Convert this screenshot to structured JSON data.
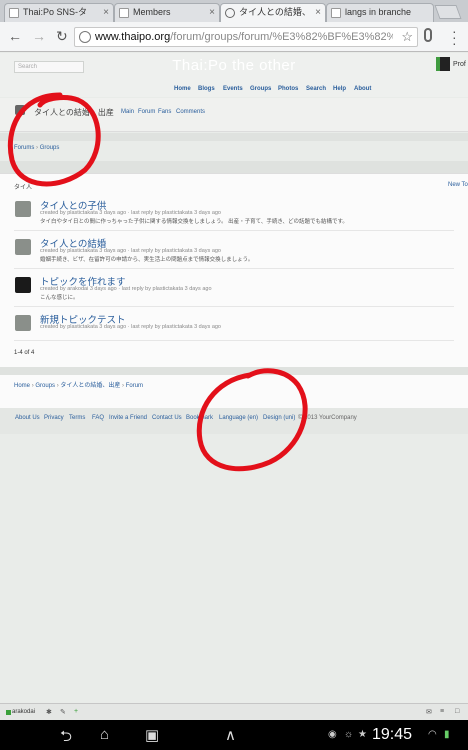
{
  "browser": {
    "tabs": [
      {
        "label": "Thai:Po SNS-タ",
        "favicon": "page-icon"
      },
      {
        "label": "Members",
        "favicon": "page-icon"
      },
      {
        "label": "タイ人との結婚、",
        "favicon": "page-icon",
        "active": true
      },
      {
        "label": "langs in branche",
        "favicon": "page-icon"
      }
    ],
    "tab_close": "×",
    "url_host": "www.thaipo.org",
    "url_path": "/forum/groups/forum/%E3%82%BF%E3%82%A4%",
    "back": "←",
    "forward": "→",
    "reload": "↻",
    "star": "☆"
  },
  "site": {
    "title": "Thai:Po the other",
    "search_placeholder": "Search",
    "profile_label": "Prof",
    "nav": [
      "Home",
      "Blogs",
      "Events",
      "Groups",
      "Photos",
      "Search",
      "Help",
      "About"
    ]
  },
  "group": {
    "name": "タイ人との結婚、出産",
    "links": [
      "Main",
      "Forum",
      "Fans",
      "Comments"
    ]
  },
  "breadcrumb_top": [
    "Forums",
    "Groups"
  ],
  "panel": {
    "heading": "タイ人",
    "new_topic": "New To"
  },
  "topics": [
    {
      "title": "タイ人との子供",
      "meta": "created by plastictakata 3 days ago · last reply by plastictakata 3 days ago",
      "desc": "タイ白やタイ日との間に作っちゃった子供に関する情報交換をしましょう。 出産・子育て、手続き、どの話題でも結構です。",
      "avatar_color": "#8a8f8a"
    },
    {
      "title": "タイ人との結婚",
      "meta": "created by plastictakata 3 days ago · last reply by plastictakata 3 days ago",
      "desc": "婚姻手続き、ビザ、在留許可の申請から、実生活上の問題点まで情報交換しましょう。",
      "avatar_color": "#8a8f8a"
    },
    {
      "title": "トピックを作れます",
      "meta": "created by arakodai 3 days ago · last reply by plastictakata 3 days ago",
      "desc": "こんな感じに。",
      "avatar_color": "#1a1a1a"
    },
    {
      "title": "新規トピックテスト",
      "meta": "created by plastictakata 3 days ago · last reply by plastictakata 3 days ago",
      "desc": "",
      "avatar_color": "#8a8f8a"
    }
  ],
  "count_text": "1-4 of 4",
  "breadcrumb_bottom": [
    "Home",
    "Groups",
    "タイ人との結婚、出産",
    "Forum"
  ],
  "footer": {
    "links": [
      "About Us",
      "Privacy",
      "Terms",
      "FAQ",
      "Invite a Friend",
      "Contact Us",
      "Bookmark",
      "Language (en)",
      "Design (uni)"
    ],
    "copyright": "© 2013 YourCompany"
  },
  "page_bottom": {
    "user": "arakodai"
  },
  "android": {
    "time": "19:45"
  }
}
